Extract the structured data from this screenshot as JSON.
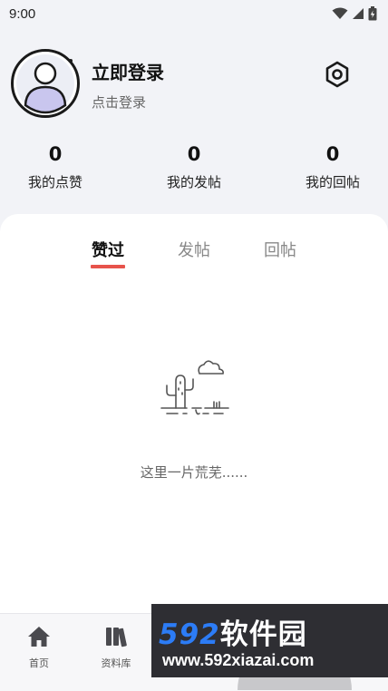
{
  "status_bar": {
    "time": "9:00"
  },
  "profile": {
    "username": "立即登录",
    "login_hint": "点击登录"
  },
  "stats": [
    {
      "count": "0",
      "label": "我的点赞"
    },
    {
      "count": "0",
      "label": "我的发帖"
    },
    {
      "count": "0",
      "label": "我的回帖"
    }
  ],
  "tabs": [
    {
      "label": "赞过",
      "active": true
    },
    {
      "label": "发帖",
      "active": false
    },
    {
      "label": "回帖",
      "active": false
    }
  ],
  "empty_state": {
    "text": "这里一片荒芜......"
  },
  "bottom_nav": [
    {
      "label": "首页",
      "icon": "home-icon"
    },
    {
      "label": "资料库",
      "icon": "library-icon"
    }
  ],
  "watermark": {
    "logo_number": "592",
    "logo_brand": "软件园",
    "url": "www.592xiazai.com"
  },
  "colors": {
    "tab_indicator": "#e7534b",
    "avatar_fill": "#c9c6ee",
    "watermark_blue": "#2c7cf6"
  }
}
